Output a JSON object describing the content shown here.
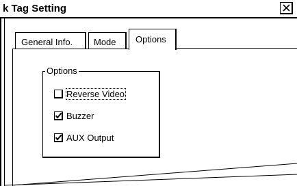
{
  "window": {
    "title": "k Tag Setting",
    "close_symbol": "✕"
  },
  "tabs": [
    {
      "label": "General Info.",
      "selected": false
    },
    {
      "label": "Mode",
      "selected": false
    },
    {
      "label": "Options",
      "selected": true
    }
  ],
  "options_group": {
    "label": "Options",
    "checkboxes": [
      {
        "label": "Reverse Video",
        "checked": false,
        "focused": true
      },
      {
        "label": "Buzzer",
        "checked": true,
        "focused": false
      },
      {
        "label": "AUX Output",
        "checked": true,
        "focused": false
      }
    ]
  },
  "icons": {
    "close": "close-icon",
    "check": "checkmark-icon"
  }
}
